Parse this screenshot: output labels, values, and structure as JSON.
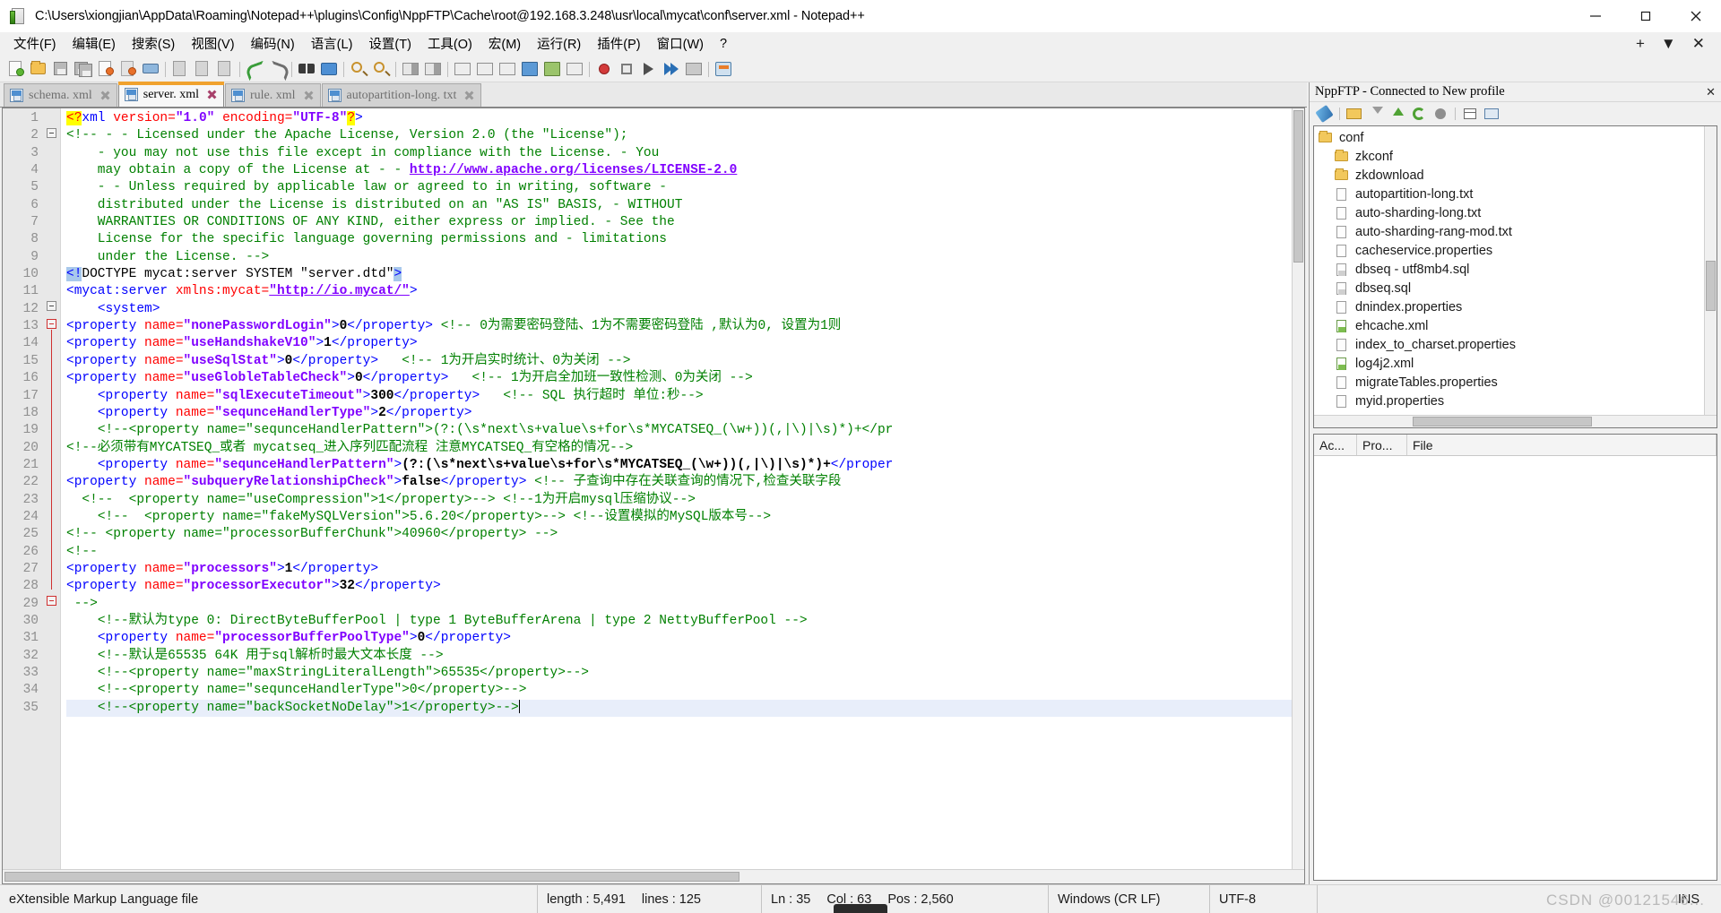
{
  "window": {
    "title": "C:\\Users\\xiongjian\\AppData\\Roaming\\Notepad++\\plugins\\Config\\NppFTP\\Cache\\root@192.168.3.248\\usr\\local\\mycat\\conf\\server.xml - Notepad++",
    "icon": "notepad-plus-plus-icon",
    "minimize": "minimize-icon",
    "maximize": "maximize-icon",
    "close": "close-icon"
  },
  "menubar": {
    "items": [
      {
        "label": "文件(F)",
        "name": "menu-file"
      },
      {
        "label": "编辑(E)",
        "name": "menu-edit"
      },
      {
        "label": "搜索(S)",
        "name": "menu-search"
      },
      {
        "label": "视图(V)",
        "name": "menu-view"
      },
      {
        "label": "编码(N)",
        "name": "menu-encoding"
      },
      {
        "label": "语言(L)",
        "name": "menu-language"
      },
      {
        "label": "设置(T)",
        "name": "menu-settings"
      },
      {
        "label": "工具(O)",
        "name": "menu-tools"
      },
      {
        "label": "宏(M)",
        "name": "menu-macro"
      },
      {
        "label": "运行(R)",
        "name": "menu-run"
      },
      {
        "label": "插件(P)",
        "name": "menu-plugins"
      },
      {
        "label": "窗口(W)",
        "name": "menu-window"
      },
      {
        "label": "?",
        "name": "menu-help"
      }
    ],
    "right": [
      "+",
      "▼",
      "✕"
    ]
  },
  "toolbar": {
    "icons": [
      "new-file-icon",
      "open-file-icon",
      "save-icon",
      "save-all-icon",
      "close-file-icon",
      "close-all-icon",
      "print-icon",
      "cut-icon",
      "copy-icon",
      "paste-icon",
      "undo-icon",
      "redo-icon",
      "find-icon",
      "replace-icon",
      "zoom-in-icon",
      "zoom-out-icon",
      "sync-vertical-scroll-icon",
      "sync-horizontal-scroll-icon",
      "word-wrap-icon",
      "show-all-chars-icon",
      "indent-guide-icon",
      "show-nonprint-icon",
      "user-defined-dialog-icon",
      "eye-icon",
      "record-macro-icon",
      "stop-record-icon",
      "play-macro-icon",
      "run-macro-multiple-icon",
      "ftp-icon"
    ]
  },
  "tabs": [
    {
      "label": "schema. xml",
      "active": false,
      "name": "tab-schema-xml"
    },
    {
      "label": "server. xml",
      "active": true,
      "name": "tab-server-xml"
    },
    {
      "label": "rule. xml",
      "active": false,
      "name": "tab-rule-xml"
    },
    {
      "label": "autopartition-long. txt",
      "active": false,
      "name": "tab-autopartition-long-txt"
    }
  ],
  "editor": {
    "first_line": 1,
    "last_line": 35,
    "current_line": 35,
    "lines": [
      {
        "n": 1,
        "segs": [
          {
            "t": "hi",
            "s": "<?"
          },
          {
            "t": "tag",
            "s": "xml"
          },
          {
            "t": "sp",
            "s": " "
          },
          {
            "t": "attr",
            "s": "version="
          },
          {
            "t": "val",
            "s": "\"1.0\""
          },
          {
            "t": "sp",
            "s": " "
          },
          {
            "t": "attr",
            "s": "encoding="
          },
          {
            "t": "val",
            "s": "\"UTF-8\""
          },
          {
            "t": "hi",
            "s": "?"
          },
          {
            "t": "tag",
            "s": ">"
          }
        ],
        "indent": 0
      },
      {
        "n": 2,
        "segs": [
          {
            "t": "cmt",
            "s": "<!-- - - Licensed under the Apache License, Version 2.0 (the \"License\");"
          }
        ],
        "indent": 0
      },
      {
        "n": 3,
        "segs": [
          {
            "t": "cmt",
            "s": "    - you may not use this file except in compliance with the License. - You"
          }
        ],
        "indent": 0
      },
      {
        "n": 4,
        "segs": [
          {
            "t": "cmt",
            "s": "    may obtain a copy of the License at - - "
          },
          {
            "t": "link",
            "s": "http://www.apache.org/licenses/LICENSE-2.0"
          }
        ],
        "indent": 0
      },
      {
        "n": 5,
        "segs": [
          {
            "t": "cmt",
            "s": "    - - Unless required by applicable law or agreed to in writing, software -"
          }
        ],
        "indent": 0
      },
      {
        "n": 6,
        "segs": [
          {
            "t": "cmt",
            "s": "    distributed under the License is distributed on an \"AS IS\" BASIS, - WITHOUT"
          }
        ],
        "indent": 0
      },
      {
        "n": 7,
        "segs": [
          {
            "t": "cmt",
            "s": "    WARRANTIES OR CONDITIONS OF ANY KIND, either express or implied. - See the"
          }
        ],
        "indent": 0
      },
      {
        "n": 8,
        "segs": [
          {
            "t": "cmt",
            "s": "    License for the specific language governing permissions and - limitations"
          }
        ],
        "indent": 0
      },
      {
        "n": 9,
        "segs": [
          {
            "t": "cmt",
            "s": "    under the License. -->"
          }
        ],
        "indent": 0
      },
      {
        "n": 10,
        "segs": [
          {
            "t": "brk",
            "s": "<!"
          },
          {
            "t": "dtd",
            "s": "DOCTYPE mycat:server SYSTEM \"server.dtd\""
          },
          {
            "t": "brk",
            "s": ">"
          }
        ],
        "indent": 0
      },
      {
        "n": 11,
        "segs": [
          {
            "t": "tag",
            "s": "<mycat:server "
          },
          {
            "t": "attr",
            "s": "xmlns:mycat="
          },
          {
            "t": "link",
            "s": "\"http://io.mycat/\""
          },
          {
            "t": "tag",
            "s": ">"
          }
        ],
        "indent": 0
      },
      {
        "n": 12,
        "segs": [
          {
            "t": "sp",
            "s": "    "
          },
          {
            "t": "tag",
            "s": "<system>"
          }
        ],
        "indent": 0
      },
      {
        "n": 13,
        "segs": [
          {
            "t": "tag",
            "s": "<property "
          },
          {
            "t": "attr",
            "s": "name="
          },
          {
            "t": "val",
            "s": "\"nonePasswordLogin\""
          },
          {
            "t": "tag",
            "s": ">"
          },
          {
            "t": "txt",
            "s": "0"
          },
          {
            "t": "tag",
            "s": "</property>"
          },
          {
            "t": "sp",
            "s": " "
          },
          {
            "t": "cmt",
            "s": "<!-- 0为需要密码登陆、1为不需要密码登陆 ,默认为0, 设置为1则"
          }
        ],
        "indent": 0
      },
      {
        "n": 14,
        "segs": [
          {
            "t": "tag",
            "s": "<property "
          },
          {
            "t": "attr",
            "s": "name="
          },
          {
            "t": "val",
            "s": "\"useHandshakeV10\""
          },
          {
            "t": "tag",
            "s": ">"
          },
          {
            "t": "txt",
            "s": "1"
          },
          {
            "t": "tag",
            "s": "</property>"
          }
        ],
        "indent": 0
      },
      {
        "n": 15,
        "segs": [
          {
            "t": "tag",
            "s": "<property "
          },
          {
            "t": "attr",
            "s": "name="
          },
          {
            "t": "val",
            "s": "\"useSqlStat\""
          },
          {
            "t": "tag",
            "s": ">"
          },
          {
            "t": "txt",
            "s": "0"
          },
          {
            "t": "tag",
            "s": "</property>"
          },
          {
            "t": "sp",
            "s": "   "
          },
          {
            "t": "cmt",
            "s": "<!-- 1为开启实时统计、0为关闭 -->"
          }
        ],
        "indent": 0
      },
      {
        "n": 16,
        "segs": [
          {
            "t": "tag",
            "s": "<property "
          },
          {
            "t": "attr",
            "s": "name="
          },
          {
            "t": "val",
            "s": "\"useGlobleTableCheck\""
          },
          {
            "t": "tag",
            "s": ">"
          },
          {
            "t": "txt",
            "s": "0"
          },
          {
            "t": "tag",
            "s": "</property>"
          },
          {
            "t": "sp",
            "s": "   "
          },
          {
            "t": "cmt",
            "s": "<!-- 1为开启全加班一致性检测、0为关闭 -->"
          }
        ],
        "indent": 0
      },
      {
        "n": 17,
        "segs": [
          {
            "t": "sp",
            "s": "    "
          },
          {
            "t": "tag",
            "s": "<property "
          },
          {
            "t": "attr",
            "s": "name="
          },
          {
            "t": "val",
            "s": "\"sqlExecuteTimeout\""
          },
          {
            "t": "tag",
            "s": ">"
          },
          {
            "t": "txt",
            "s": "300"
          },
          {
            "t": "tag",
            "s": "</property>"
          },
          {
            "t": "sp",
            "s": "   "
          },
          {
            "t": "cmt",
            "s": "<!-- SQL 执行超时 单位:秒-->"
          }
        ],
        "indent": 0
      },
      {
        "n": 18,
        "segs": [
          {
            "t": "sp",
            "s": "    "
          },
          {
            "t": "tag",
            "s": "<property "
          },
          {
            "t": "attr",
            "s": "name="
          },
          {
            "t": "val",
            "s": "\"sequnceHandlerType\""
          },
          {
            "t": "tag",
            "s": ">"
          },
          {
            "t": "txt",
            "s": "2"
          },
          {
            "t": "tag",
            "s": "</property>"
          }
        ],
        "indent": 0
      },
      {
        "n": 19,
        "segs": [
          {
            "t": "sp",
            "s": "    "
          },
          {
            "t": "cmt",
            "s": "<!--<property name=\"sequnceHandlerPattern\">(?:(\\s*next\\s+value\\s+for\\s*MYCATSEQ_(\\w+))(,|\\)|\\s)*)+</pr"
          }
        ],
        "indent": 0
      },
      {
        "n": 20,
        "segs": [
          {
            "t": "cmt",
            "s": "<!--必须带有MYCATSEQ_或者 mycatseq_进入序列匹配流程 注意MYCATSEQ_有空格的情况-->"
          }
        ],
        "indent": 0
      },
      {
        "n": 21,
        "segs": [
          {
            "t": "sp",
            "s": "    "
          },
          {
            "t": "tag",
            "s": "<property "
          },
          {
            "t": "attr",
            "s": "name="
          },
          {
            "t": "val",
            "s": "\"sequnceHandlerPattern\""
          },
          {
            "t": "tag",
            "s": ">"
          },
          {
            "t": "txt",
            "s": "(?:(\\s*next\\s+value\\s+for\\s*MYCATSEQ_(\\w+))(,|\\)|\\s)*)+"
          },
          {
            "t": "tag",
            "s": "</proper"
          }
        ],
        "indent": 0
      },
      {
        "n": 22,
        "segs": [
          {
            "t": "tag",
            "s": "<property "
          },
          {
            "t": "attr",
            "s": "name="
          },
          {
            "t": "val",
            "s": "\"subqueryRelationshipCheck\""
          },
          {
            "t": "tag",
            "s": ">"
          },
          {
            "t": "txt",
            "s": "false"
          },
          {
            "t": "tag",
            "s": "</property>"
          },
          {
            "t": "sp",
            "s": " "
          },
          {
            "t": "cmt",
            "s": "<!-- 子查询中存在关联查询的情况下,检查关联字段"
          }
        ],
        "indent": 0
      },
      {
        "n": 23,
        "segs": [
          {
            "t": "sp",
            "s": "  "
          },
          {
            "t": "cmt",
            "s": "<!--  <property name=\"useCompression\">1</property>--> <!--1为开启mysql压缩协议-->"
          }
        ],
        "indent": 0
      },
      {
        "n": 24,
        "segs": [
          {
            "t": "sp",
            "s": "    "
          },
          {
            "t": "cmt",
            "s": "<!--  <property name=\"fakeMySQLVersion\">5.6.20</property>--> <!--设置模拟的MySQL版本号-->"
          }
        ],
        "indent": 0
      },
      {
        "n": 25,
        "segs": [
          {
            "t": "cmt",
            "s": "<!-- <property name=\"processorBufferChunk\">40960</property> -->"
          }
        ],
        "indent": 0
      },
      {
        "n": 26,
        "segs": [
          {
            "t": "cmt",
            "s": "<!--"
          }
        ],
        "indent": 0
      },
      {
        "n": 27,
        "segs": [
          {
            "t": "tag",
            "s": "<property "
          },
          {
            "t": "attr",
            "s": "name="
          },
          {
            "t": "val",
            "s": "\"processors\""
          },
          {
            "t": "tag",
            "s": ">"
          },
          {
            "t": "txt",
            "s": "1"
          },
          {
            "t": "tag",
            "s": "</property>"
          }
        ],
        "indent": 0
      },
      {
        "n": 28,
        "segs": [
          {
            "t": "tag",
            "s": "<property "
          },
          {
            "t": "attr",
            "s": "name="
          },
          {
            "t": "val",
            "s": "\"processorExecutor\""
          },
          {
            "t": "tag",
            "s": ">"
          },
          {
            "t": "txt",
            "s": "32"
          },
          {
            "t": "tag",
            "s": "</property>"
          }
        ],
        "indent": 0
      },
      {
        "n": 29,
        "segs": [
          {
            "t": "sp",
            "s": " "
          },
          {
            "t": "cmt",
            "s": "-->"
          }
        ],
        "indent": 0
      },
      {
        "n": 30,
        "segs": [
          {
            "t": "sp",
            "s": "    "
          },
          {
            "t": "cmt",
            "s": "<!--默认为type 0: DirectByteBufferPool | type 1 ByteBufferArena | type 2 NettyBufferPool -->"
          }
        ],
        "indent": 0
      },
      {
        "n": 31,
        "segs": [
          {
            "t": "sp",
            "s": "    "
          },
          {
            "t": "tag",
            "s": "<property "
          },
          {
            "t": "attr",
            "s": "name="
          },
          {
            "t": "val",
            "s": "\"processorBufferPoolType\""
          },
          {
            "t": "tag",
            "s": ">"
          },
          {
            "t": "txt",
            "s": "0"
          },
          {
            "t": "tag",
            "s": "</property>"
          }
        ],
        "indent": 0
      },
      {
        "n": 32,
        "segs": [
          {
            "t": "sp",
            "s": "    "
          },
          {
            "t": "cmt",
            "s": "<!--默认是65535 64K 用于sql解析时最大文本长度 -->"
          }
        ],
        "indent": 0
      },
      {
        "n": 33,
        "segs": [
          {
            "t": "sp",
            "s": "    "
          },
          {
            "t": "cmt",
            "s": "<!--<property name=\"maxStringLiteralLength\">65535</property>-->"
          }
        ],
        "indent": 0
      },
      {
        "n": 34,
        "segs": [
          {
            "t": "sp",
            "s": "    "
          },
          {
            "t": "cmt",
            "s": "<!--<property name=\"sequnceHandlerType\">0</property>-->"
          }
        ],
        "indent": 0
      },
      {
        "n": 35,
        "segs": [
          {
            "t": "sp",
            "s": "    "
          },
          {
            "t": "cmt",
            "s": "<!--<property name=\"backSocketNoDelay\">1</property>-->"
          },
          {
            "t": "caret",
            "s": ""
          }
        ],
        "indent": 0,
        "current": true
      }
    ]
  },
  "ftp": {
    "title": "NppFTP - Connected to New profile",
    "close_label": "✕",
    "toolbar_icons": [
      "connect-icon",
      "open-folder-icon",
      "download-icon",
      "upload-icon",
      "refresh-icon",
      "abort-icon",
      "settings-icon",
      "messages-icon"
    ],
    "tree": [
      {
        "label": "conf",
        "icon": "folder-icon",
        "level": 0,
        "selected": true,
        "name": "tree-item-conf"
      },
      {
        "label": "zkconf",
        "icon": "folder-icon",
        "level": 1,
        "name": "tree-item-zkconf"
      },
      {
        "label": "zkdownload",
        "icon": "folder-icon",
        "level": 1,
        "name": "tree-item-zkdownload"
      },
      {
        "label": "autopartition-long.txt",
        "icon": "file-icon",
        "level": 1,
        "name": "tree-item-autopartition-long-txt"
      },
      {
        "label": "auto-sharding-long.txt",
        "icon": "file-icon",
        "level": 1,
        "name": "tree-item-auto-sharding-long-txt"
      },
      {
        "label": "auto-sharding-rang-mod.txt",
        "icon": "file-icon",
        "level": 1,
        "name": "tree-item-auto-sharding-rang-mod-txt"
      },
      {
        "label": "cacheservice.properties",
        "icon": "file-icon",
        "level": 1,
        "name": "tree-item-cacheservice-properties"
      },
      {
        "label": "dbseq - utf8mb4.sql",
        "icon": "file-sql-icon",
        "level": 1,
        "name": "tree-item-dbseq-utf8mb4-sql"
      },
      {
        "label": "dbseq.sql",
        "icon": "file-sql-icon",
        "level": 1,
        "name": "tree-item-dbseq-sql"
      },
      {
        "label": "dnindex.properties",
        "icon": "file-icon",
        "level": 1,
        "name": "tree-item-dnindex-properties"
      },
      {
        "label": "ehcache.xml",
        "icon": "file-xml-icon",
        "level": 1,
        "name": "tree-item-ehcache-xml"
      },
      {
        "label": "index_to_charset.properties",
        "icon": "file-icon",
        "level": 1,
        "name": "tree-item-index-to-charset-properties"
      },
      {
        "label": "log4j2.xml",
        "icon": "file-xml-icon",
        "level": 1,
        "name": "tree-item-log4j2-xml"
      },
      {
        "label": "migrateTables.properties",
        "icon": "file-icon",
        "level": 1,
        "name": "tree-item-migratetables-properties"
      },
      {
        "label": "myid.properties",
        "icon": "file-icon",
        "level": 1,
        "name": "tree-item-myid-properties"
      }
    ],
    "queue_columns": [
      "Ac...",
      "Pro...",
      "File"
    ]
  },
  "statusbar": {
    "file_type": "eXtensible Markup Language file",
    "length_label": "length : 5,491",
    "lines_label": "lines : 125",
    "ln": "Ln : 35",
    "col": "Col : 63",
    "pos": "Pos : 2,560",
    "eol": "Windows (CR LF)",
    "encoding": "UTF-8",
    "insert_mode": "INS"
  },
  "watermark": "CSDN @00121546..."
}
